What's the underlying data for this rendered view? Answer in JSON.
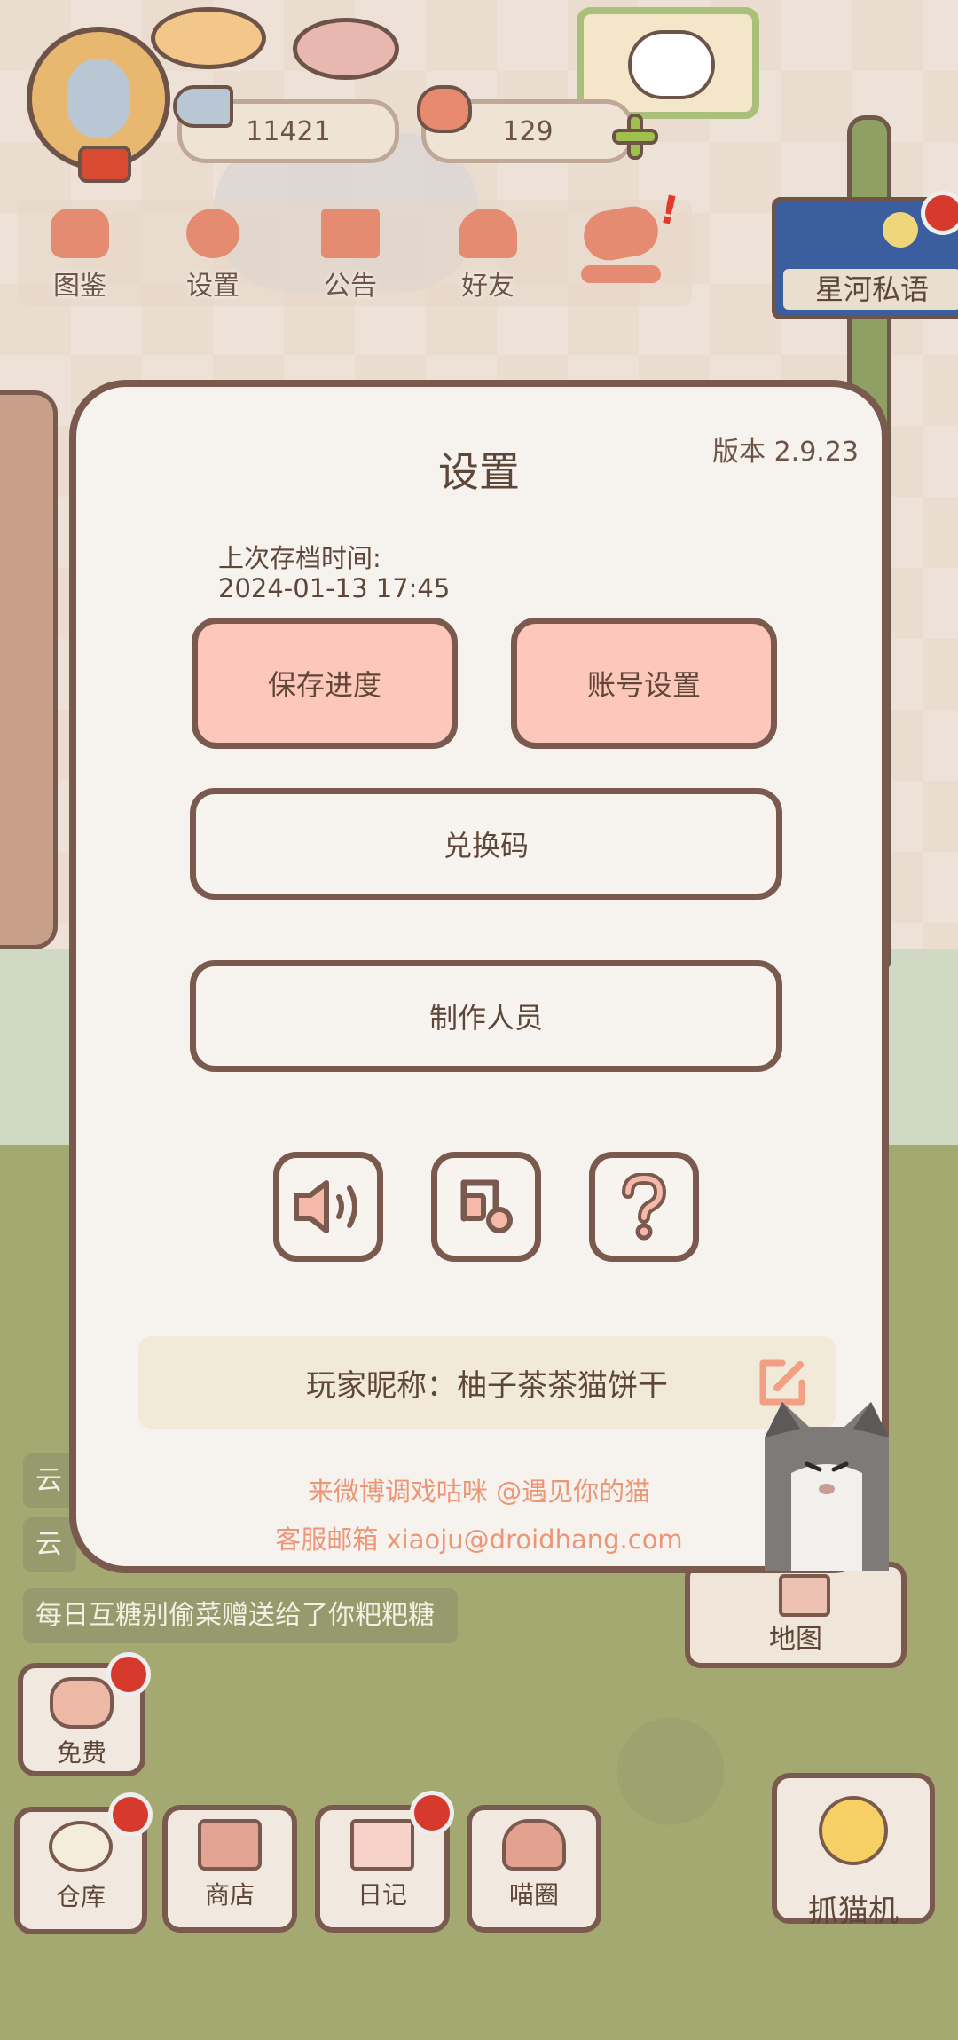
{
  "hud": {
    "fish_count": "11421",
    "heart_count": "129"
  },
  "top_menu": [
    {
      "label": "图鉴"
    },
    {
      "label": "设置"
    },
    {
      "label": "公告"
    },
    {
      "label": "好友"
    }
  ],
  "starry_sign": {
    "label": "星河私语"
  },
  "settings": {
    "title": "设置",
    "version": "版本 2.9.23",
    "last_save_label": "上次存档时间:",
    "last_save_time": "2024-01-13 17:45",
    "save_button": "保存进度",
    "account_button": "账号设置",
    "redeem_button": "兑换码",
    "credits_button": "制作人员",
    "icons": [
      "speaker-icon",
      "music-note-icon",
      "question-icon"
    ],
    "nickname": "玩家昵称：柚子茶茶猫饼干",
    "weibo_text": "来微博调戏咕咪 @遇见你的猫",
    "email_text": "客服邮箱 xiaoju@droidhang.com"
  },
  "feed": {
    "line1": "云",
    "line2": "云",
    "line3": "每日互糖别偷菜赠送给了你粑粑糖"
  },
  "map_button": {
    "label": "地图"
  },
  "bottom_bar": {
    "free": "免费",
    "storage": "仓库",
    "shop": "商店",
    "diary": "日记",
    "circle": "喵圈",
    "claw": "抓猫机"
  },
  "colors": {
    "accent_pink": "#fec7bb",
    "border_brown": "#7a5a4e",
    "link_orange": "#ec9677",
    "badge_red": "#d63a2d"
  }
}
